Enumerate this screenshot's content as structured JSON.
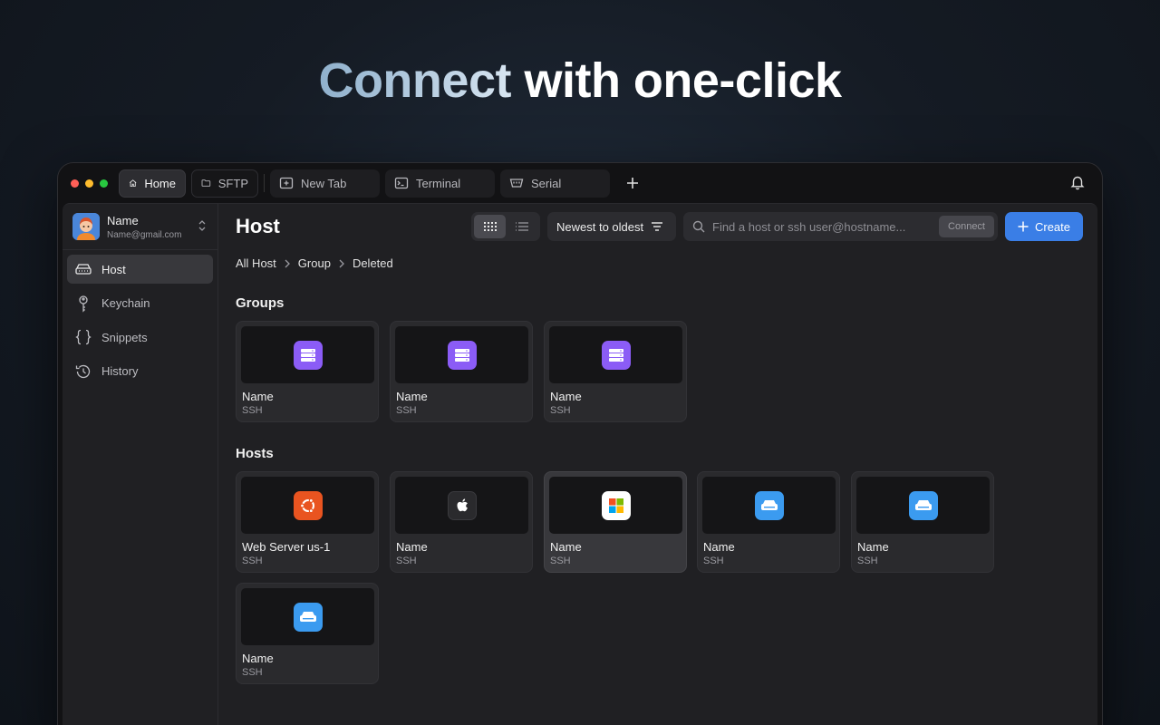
{
  "headline": {
    "accent": "Connect",
    "rest": " with one-click"
  },
  "tabs": [
    {
      "label": "Home",
      "icon": "home-icon"
    },
    {
      "label": "SFTP",
      "icon": "folder-icon"
    },
    {
      "label": "New Tab",
      "icon": "new-tab-icon"
    },
    {
      "label": "Terminal",
      "icon": "terminal-icon"
    },
    {
      "label": "Serial",
      "icon": "serial-icon"
    }
  ],
  "profile": {
    "name": "Name",
    "email": "Name@gmail.com"
  },
  "sidebar": {
    "items": [
      {
        "label": "Host",
        "icon": "server-icon"
      },
      {
        "label": "Keychain",
        "icon": "key-icon"
      },
      {
        "label": "Snippets",
        "icon": "braces-icon"
      },
      {
        "label": "History",
        "icon": "history-icon"
      }
    ]
  },
  "header": {
    "title": "Host",
    "sort_label": "Newest to oldest",
    "search_placeholder": "Find a host or ssh user@hostname...",
    "connect_label": "Connect",
    "create_label": "Create"
  },
  "breadcrumb": [
    "All Host",
    "Group",
    "Deleted"
  ],
  "groups": {
    "title": "Groups",
    "items": [
      {
        "name": "Name",
        "protocol": "SSH",
        "icon": "group-server-icon"
      },
      {
        "name": "Name",
        "protocol": "SSH",
        "icon": "group-server-icon"
      },
      {
        "name": "Name",
        "protocol": "SSH",
        "icon": "group-server-icon"
      }
    ]
  },
  "hosts": {
    "title": "Hosts",
    "items": [
      {
        "name": "Web Server us-1",
        "protocol": "SSH",
        "icon": "ubuntu-icon"
      },
      {
        "name": "Name",
        "protocol": "SSH",
        "icon": "apple-icon"
      },
      {
        "name": "Name",
        "protocol": "SSH",
        "icon": "windows-icon"
      },
      {
        "name": "Name",
        "protocol": "SSH",
        "icon": "server-icon"
      },
      {
        "name": "Name",
        "protocol": "SSH",
        "icon": "server-icon"
      },
      {
        "name": "Name",
        "protocol": "SSH",
        "icon": "server-icon"
      }
    ]
  },
  "colors": {
    "accent": "#3a7ee6",
    "group_icon": "#8b5cf6",
    "ubuntu": "#e95420",
    "server_blue": "#3b9bf0"
  }
}
